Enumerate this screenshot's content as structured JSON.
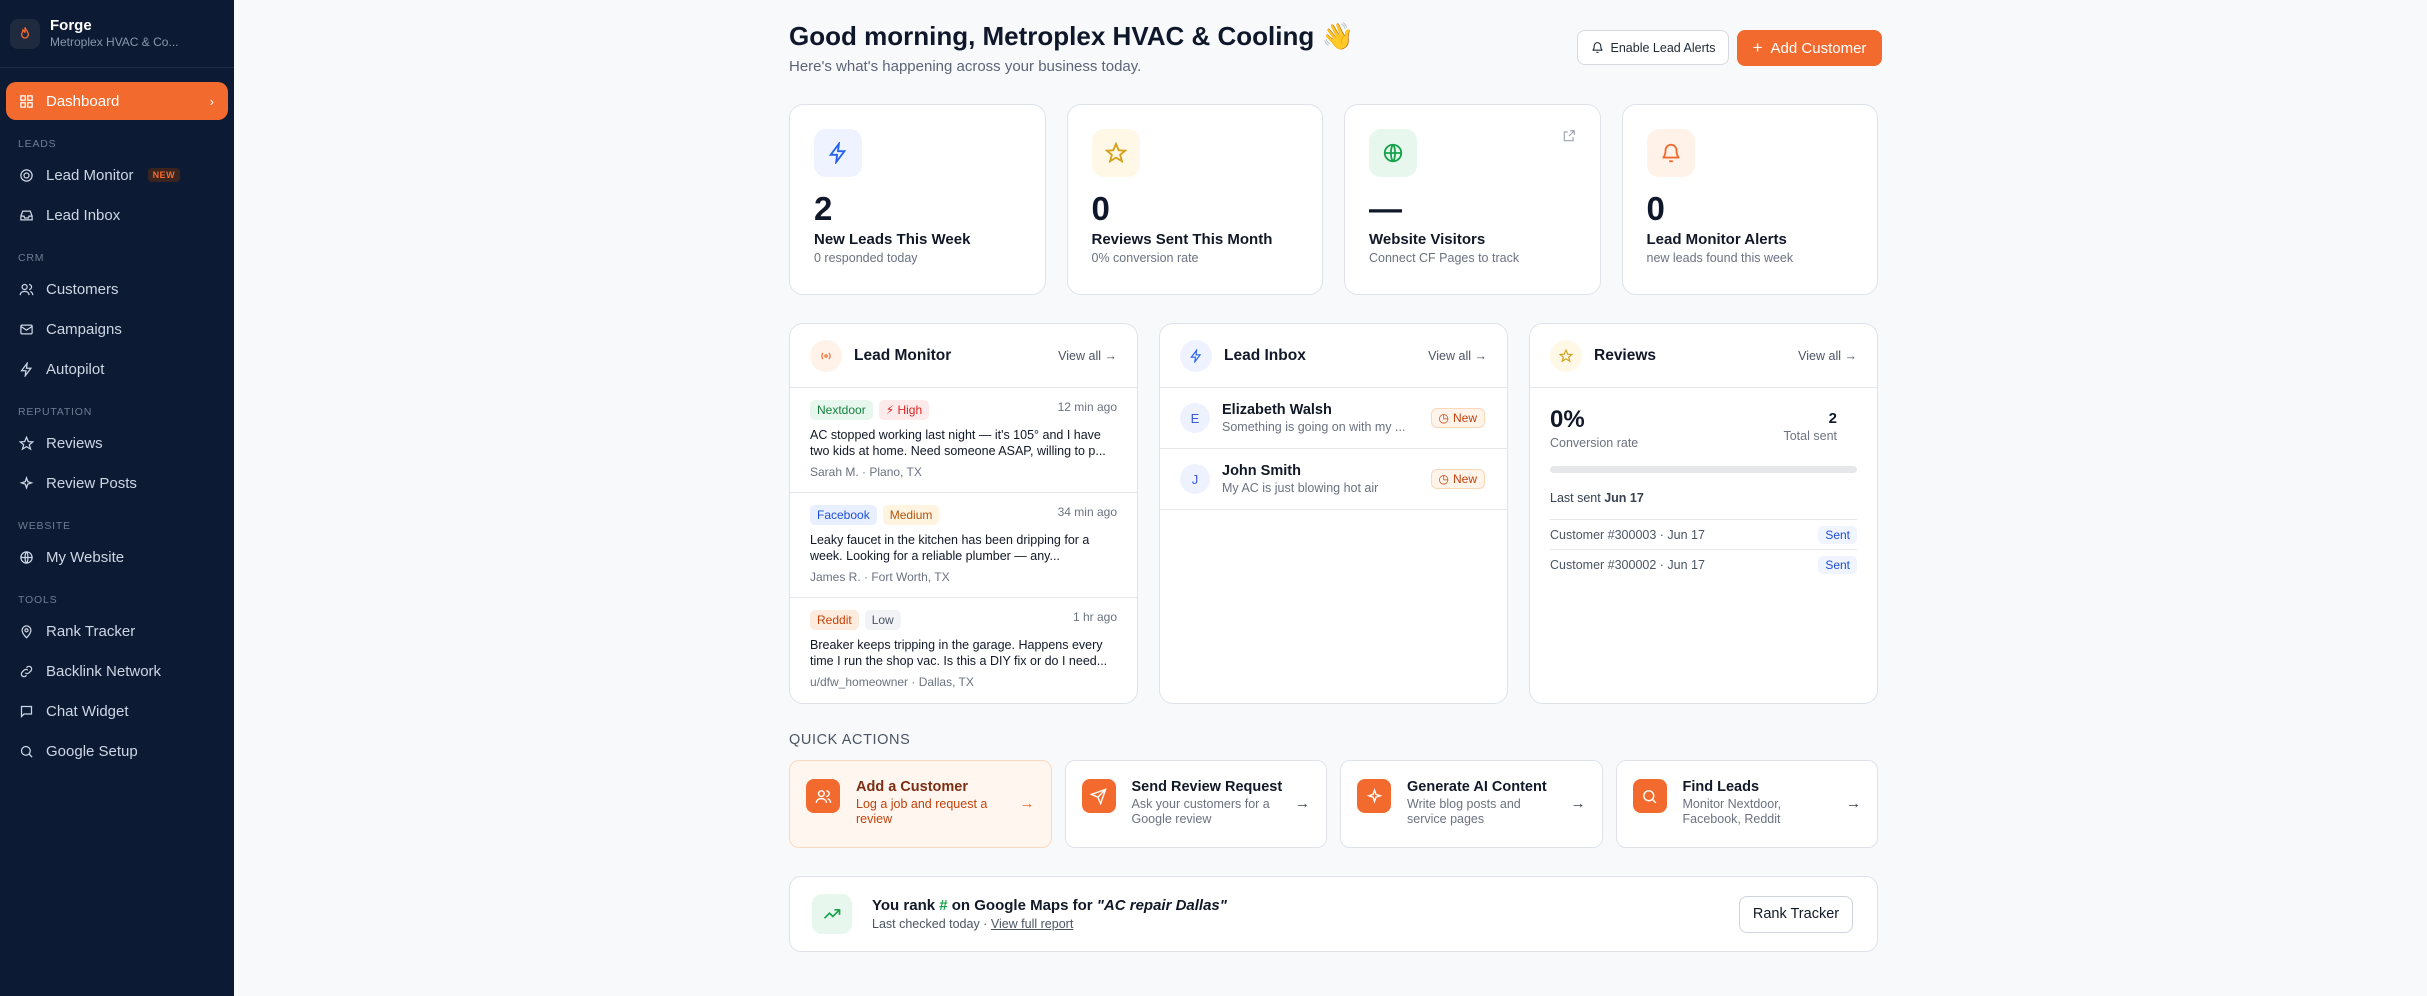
{
  "brand": {
    "name": "Forge",
    "sub": "Metroplex HVAC & Co..."
  },
  "nav": {
    "dashboard": "Dashboard",
    "sections": {
      "leads": "LEADS",
      "crm": "CRM",
      "reputation": "REPUTATION",
      "website": "WEBSITE",
      "tools": "TOOLS"
    },
    "lead_monitor": "Lead Monitor",
    "new_badge": "NEW",
    "lead_inbox": "Lead Inbox",
    "customers": "Customers",
    "campaigns": "Campaigns",
    "autopilot": "Autopilot",
    "reviews": "Reviews",
    "review_posts": "Review Posts",
    "my_website": "My Website",
    "rank_tracker": "Rank Tracker",
    "backlink_network": "Backlink Network",
    "chat_widget": "Chat Widget",
    "google_setup": "Google Setup"
  },
  "header": {
    "greeting": "Good morning, Metroplex HVAC & Cooling 👋",
    "subtitle": "Here's what's happening across your business today.",
    "alerts_button": "Enable Lead Alerts",
    "add_button": "Add Customer"
  },
  "stats": [
    {
      "value": "2",
      "label": "New Leads This Week",
      "sub": "0 responded today",
      "icon": "bolt-icon"
    },
    {
      "value": "0",
      "label": "Reviews Sent This Month",
      "sub": "0% conversion rate",
      "icon": "star-icon"
    },
    {
      "value": "—",
      "label": "Website Visitors",
      "sub": "Connect CF Pages to track",
      "icon": "globe-icon"
    },
    {
      "value": "0",
      "label": "Lead Monitor Alerts",
      "sub": "new leads found this week",
      "icon": "bell-icon"
    }
  ],
  "lead_monitor": {
    "title": "Lead Monitor",
    "view_all": "View all →",
    "items": [
      {
        "source": "Nextdoor",
        "priority": "High",
        "time": "12 min ago",
        "text": "AC stopped working last night — it's 105° and I have two kids at home. Need someone ASAP, willing to p...",
        "meta": "Sarah M. · Plano, TX"
      },
      {
        "source": "Facebook",
        "priority": "Medium",
        "time": "34 min ago",
        "text": "Leaky faucet in the kitchen has been dripping for a week. Looking for a reliable plumber — any...",
        "meta": "James R. · Fort Worth, TX"
      },
      {
        "source": "Reddit",
        "priority": "Low",
        "time": "1 hr ago",
        "text": "Breaker keeps tripping in the garage. Happens every time I run the shop vac. Is this a DIY fix or do I need...",
        "meta": "u/dfw_homeowner · Dallas, TX"
      }
    ]
  },
  "lead_inbox": {
    "title": "Lead Inbox",
    "view_all": "View all →",
    "items": [
      {
        "initial": "E",
        "name": "Elizabeth Walsh",
        "msg": "Something is going on with my ...",
        "status": "New"
      },
      {
        "initial": "J",
        "name": "John Smith",
        "msg": "My AC is just blowing hot air",
        "status": "New"
      }
    ]
  },
  "reviews": {
    "title": "Reviews",
    "view_all": "View all →",
    "conversion": "0%",
    "conversion_label": "Conversion rate",
    "conversion_fraction": 0,
    "total": "2",
    "total_label": "Total sent",
    "last_sent_label": "Last sent",
    "last_sent": "Jun 17",
    "rows": [
      {
        "text": "Customer #300003 · Jun 17",
        "status": "Sent"
      },
      {
        "text": "Customer #300002 · Jun 17",
        "status": "Sent"
      }
    ]
  },
  "quick_actions": {
    "title": "QUICK ACTIONS",
    "items": [
      {
        "name": "Add a Customer",
        "desc": "Log a job and request a review",
        "icon": "users-icon"
      },
      {
        "name": "Send Review Request",
        "desc": "Ask your customers for a Google review",
        "icon": "send-icon"
      },
      {
        "name": "Generate AI Content",
        "desc": "Write blog posts and service pages",
        "icon": "sparkle-icon"
      },
      {
        "name": "Find Leads",
        "desc": "Monitor Nextdoor, Facebook, Reddit",
        "icon": "search-icon"
      }
    ]
  },
  "rank": {
    "prefix": "You rank",
    "hash": "#",
    "middle": "on Google Maps for",
    "query": "\"AC repair Dallas\"",
    "sub": "Last checked today ·",
    "link": "View full report",
    "button": "Rank Tracker"
  },
  "colors": {
    "accent": "#f26a2e",
    "sidebar": "#0c1a33"
  }
}
